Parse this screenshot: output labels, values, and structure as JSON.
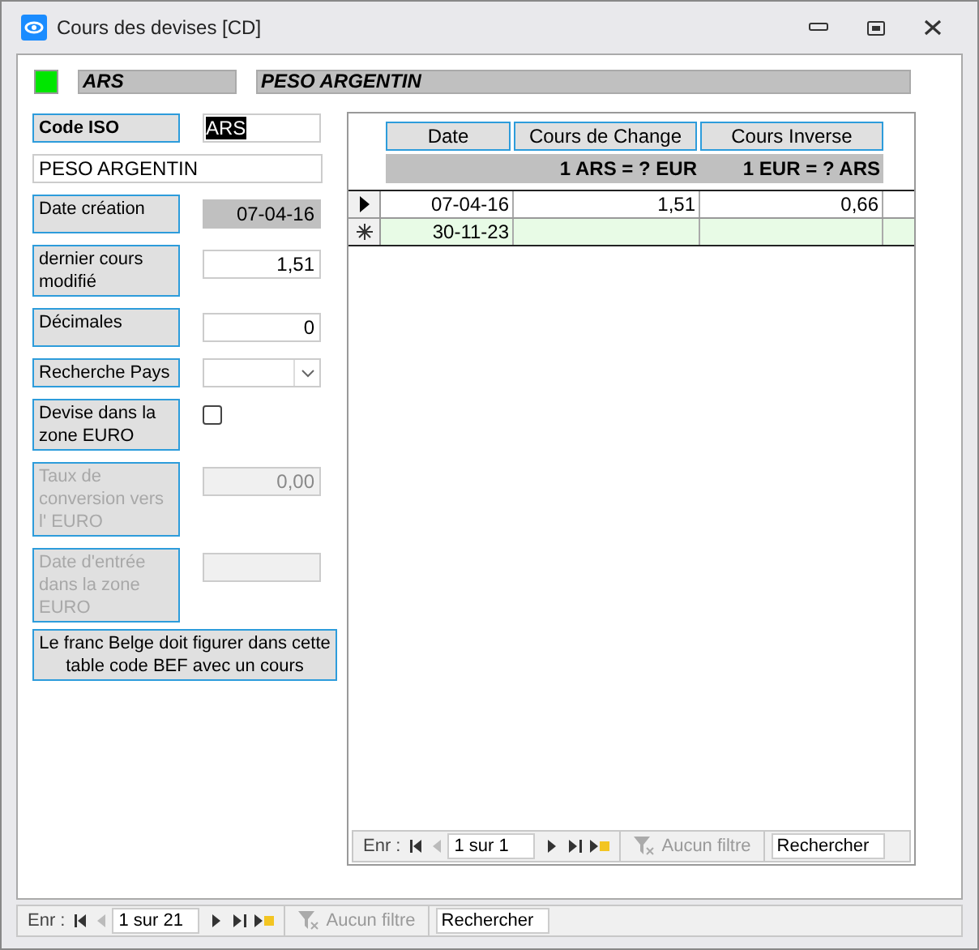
{
  "window": {
    "title": "Cours des devises [CD]"
  },
  "header": {
    "code": "ARS",
    "name": "PESO ARGENTIN"
  },
  "code_iso": {
    "label": "Code ISO",
    "value": "ARS",
    "selected": true
  },
  "name_field": {
    "value": "PESO ARGENTIN"
  },
  "fields": [
    {
      "kind": "text",
      "label": "Date création",
      "value": "07-04-16",
      "readonly": true,
      "disabled": false
    },
    {
      "kind": "text",
      "label": "dernier cours modifié",
      "value": "1,51",
      "readonly": false,
      "disabled": false
    },
    {
      "kind": "text",
      "label": "Décimales",
      "value": "0",
      "readonly": false,
      "disabled": false
    },
    {
      "kind": "combo",
      "label": "Recherche Pays",
      "disabled": false
    },
    {
      "kind": "checkbox",
      "label": "Devise dans la zone EURO",
      "checked": false,
      "disabled": false
    },
    {
      "kind": "text",
      "label": "Taux de conversion vers l' EURO",
      "value": "0,00",
      "readonly": false,
      "disabled": true
    },
    {
      "kind": "text",
      "label": "Date d'entrée dans la zone EURO",
      "readonly": false,
      "disabled": true
    }
  ],
  "note_button": "Le franc Belge doit figurer dans cette table code BEF avec un cours",
  "subform": {
    "columns": [
      "Date",
      "Cours de Change",
      "Cours Inverse"
    ],
    "subheaders": [
      "1 ARS = ? EUR",
      "1 EUR = ? ARS"
    ],
    "rows": [
      {
        "kind": "current",
        "cells": [
          "07-04-16",
          "1,51",
          "0,66"
        ]
      },
      {
        "kind": "new",
        "cells": [
          "30-11-23"
        ]
      }
    ],
    "nav": {
      "label": "Enr :",
      "position": "1 sur 1",
      "filter": "Aucun filtre",
      "search": "Rechercher"
    }
  },
  "nav": {
    "label": "Enr :",
    "position": "1 sur 21",
    "filter": "Aucun filtre",
    "search": "Rechercher"
  }
}
